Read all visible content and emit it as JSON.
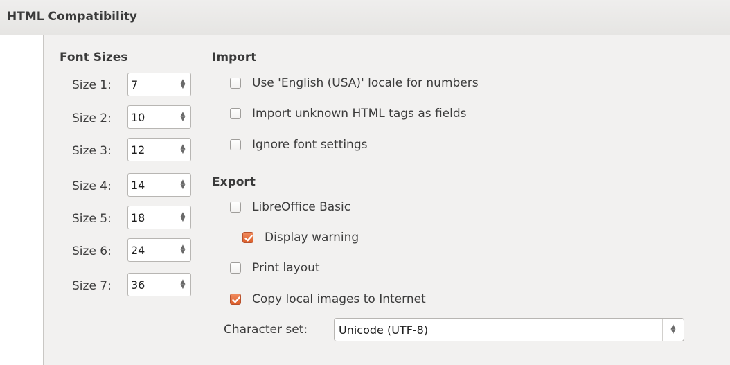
{
  "header": {
    "title": "HTML Compatibility"
  },
  "font_sizes": {
    "title": "Font Sizes",
    "items": [
      {
        "label": "Size 1:",
        "value": "7"
      },
      {
        "label": "Size 2:",
        "value": "10"
      },
      {
        "label": "Size 3:",
        "value": "12"
      },
      {
        "label": "Size 4:",
        "value": "14"
      },
      {
        "label": "Size 5:",
        "value": "18"
      },
      {
        "label": "Size 6:",
        "value": "24"
      },
      {
        "label": "Size 7:",
        "value": "36"
      }
    ]
  },
  "import": {
    "title": "Import",
    "options": [
      {
        "label": "Use 'English (USA)' locale for numbers",
        "checked": false
      },
      {
        "label": "Import unknown HTML tags as fields",
        "checked": false
      },
      {
        "label": "Ignore font settings",
        "checked": false
      }
    ]
  },
  "export": {
    "title": "Export",
    "options": [
      {
        "label": "LibreOffice Basic",
        "checked": false
      },
      {
        "label": "Display warning",
        "checked": true
      },
      {
        "label": "Print layout",
        "checked": false
      },
      {
        "label": "Copy local images to Internet",
        "checked": true
      }
    ],
    "charset_label": "Character set:",
    "charset_value": "Unicode (UTF-8)"
  },
  "icons": {
    "spin": "spin-up-down-icon",
    "dropdown": "dropdown-arrows-icon",
    "check": "checkmark-icon"
  },
  "colors": {
    "check_accent": "#e0652f",
    "background": "#f2f1f0"
  }
}
